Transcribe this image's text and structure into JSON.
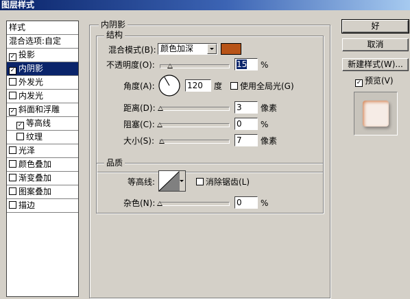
{
  "window": {
    "title": "图层样式"
  },
  "colors": {
    "shadow_color": "#b85418",
    "selection": "#0a246a",
    "titlebar": "#0a246a"
  },
  "sidebar": {
    "header": "样式",
    "blend_options": "混合选项:自定",
    "items": [
      {
        "label": "投影",
        "checked": true,
        "selected": false,
        "indent": false
      },
      {
        "label": "内阴影",
        "checked": true,
        "selected": true,
        "indent": false
      },
      {
        "label": "外发光",
        "checked": false,
        "selected": false,
        "indent": false
      },
      {
        "label": "内发光",
        "checked": false,
        "selected": false,
        "indent": false
      },
      {
        "label": "斜面和浮雕",
        "checked": true,
        "selected": false,
        "indent": false
      },
      {
        "label": "等高线",
        "checked": true,
        "selected": false,
        "indent": true
      },
      {
        "label": "纹理",
        "checked": false,
        "selected": false,
        "indent": true
      },
      {
        "label": "光泽",
        "checked": false,
        "selected": false,
        "indent": false
      },
      {
        "label": "颜色叠加",
        "checked": false,
        "selected": false,
        "indent": false
      },
      {
        "label": "渐变叠加",
        "checked": false,
        "selected": false,
        "indent": false
      },
      {
        "label": "图案叠加",
        "checked": false,
        "selected": false,
        "indent": false
      },
      {
        "label": "描边",
        "checked": false,
        "selected": false,
        "indent": false
      }
    ]
  },
  "panel": {
    "title": "内阴影",
    "structure": {
      "title": "结构",
      "blend_mode_label": "混合模式(B):",
      "blend_mode_value": "颜色加深",
      "opacity_label": "不透明度(O):",
      "opacity_value": "15",
      "opacity_unit": "%",
      "opacity_fraction": 0.15,
      "angle_label": "角度(A):",
      "angle_value": "120",
      "angle_unit": "度",
      "global_light_label": "使用全局光(G)",
      "global_light_checked": false,
      "distance_label": "距离(D):",
      "distance_value": "3",
      "distance_unit": "像素",
      "distance_fraction": 0.01,
      "choke_label": "阻塞(C):",
      "choke_value": "0",
      "choke_unit": "%",
      "choke_fraction": 0,
      "size_label": "大小(S):",
      "size_value": "7",
      "size_unit": "像素",
      "size_fraction": 0.03
    },
    "quality": {
      "title": "品质",
      "contour_label": "等高线:",
      "antialias_label": "消除锯齿(L)",
      "antialias_checked": false,
      "noise_label": "杂色(N):",
      "noise_value": "0",
      "noise_unit": "%",
      "noise_fraction": 0
    }
  },
  "actions": {
    "ok": "好",
    "cancel": "取消",
    "new_style": "新建样式(W)...",
    "preview_label": "预览(V)",
    "preview_checked": true
  }
}
